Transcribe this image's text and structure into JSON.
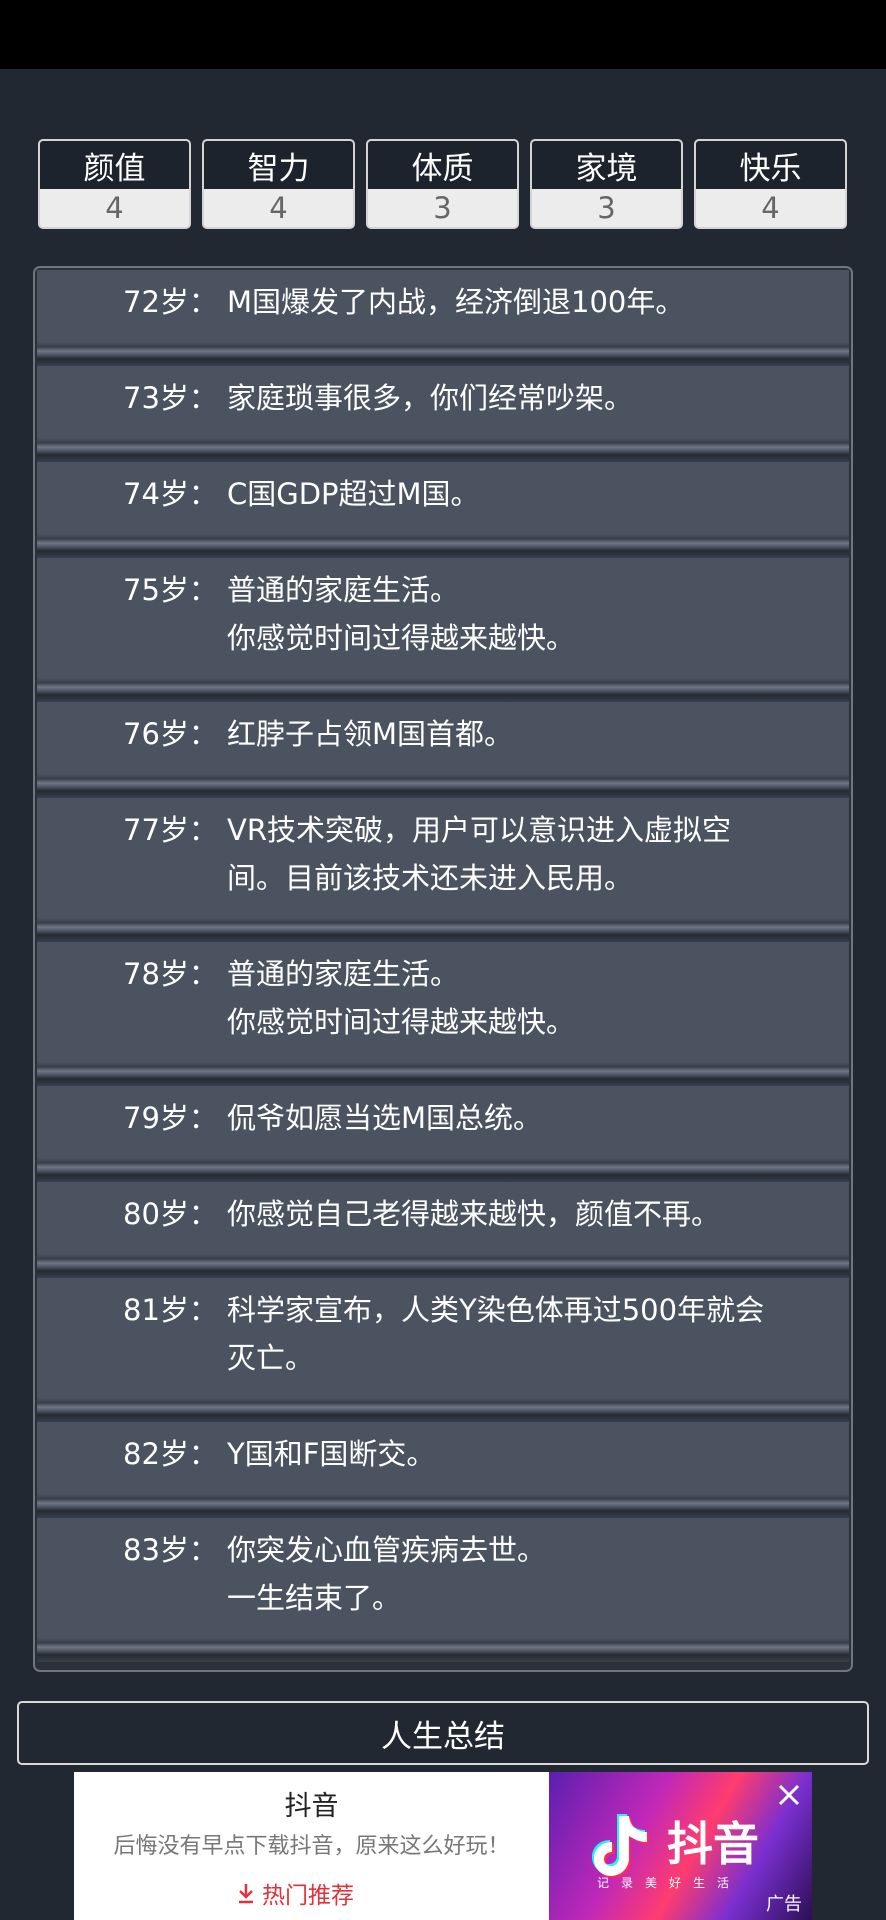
{
  "stats": [
    {
      "label": "颜值",
      "value": "4"
    },
    {
      "label": "智力",
      "value": "4"
    },
    {
      "label": "体质",
      "value": "3"
    },
    {
      "label": "家境",
      "value": "3"
    },
    {
      "label": "快乐",
      "value": "4"
    }
  ],
  "events": [
    {
      "age": "72岁：",
      "lines": [
        "M国爆发了内战，经济倒退100年。"
      ]
    },
    {
      "age": "73岁：",
      "lines": [
        "家庭琐事很多，你们经常吵架。"
      ]
    },
    {
      "age": "74岁：",
      "lines": [
        "C国GDP超过M国。"
      ]
    },
    {
      "age": "75岁：",
      "lines": [
        "普通的家庭生活。",
        "你感觉时间过得越来越快。"
      ]
    },
    {
      "age": "76岁：",
      "lines": [
        "红脖子占领M国首都。"
      ]
    },
    {
      "age": "77岁：",
      "lines": [
        "VR技术突破，用户可以意识进入虚拟空",
        "间。目前该技术还未进入民用。"
      ]
    },
    {
      "age": "78岁：",
      "lines": [
        "普通的家庭生活。",
        "你感觉时间过得越来越快。"
      ]
    },
    {
      "age": "79岁：",
      "lines": [
        "侃爷如愿当选M国总统。"
      ]
    },
    {
      "age": "80岁：",
      "lines": [
        "你感觉自己老得越来越快，颜值不再。"
      ]
    },
    {
      "age": "81岁：",
      "lines": [
        "科学家宣布，人类Y染色体再过500年就会",
        "灭亡。"
      ]
    },
    {
      "age": "82岁：",
      "lines": [
        "Y国和F国断交。"
      ]
    },
    {
      "age": "83岁：",
      "lines": [
        "你突发心血管疾病去世。",
        "一生结束了。"
      ]
    }
  ],
  "summary_button": "人生总结",
  "ad": {
    "title": "抖音",
    "description": "后悔没有早点下载抖音，原来这么好玩！",
    "cta": "热门推荐",
    "brand": "抖音",
    "slogan": "记录美好生活",
    "badge": "广告",
    "close_icon": "close-icon",
    "cta_icon": "download-arrow-icon",
    "logo_icon": "douyin-note-icon"
  },
  "colors": {
    "background": "#222831",
    "event_card": "#4b5361",
    "stat_header": "#1d232c",
    "stat_value_bg": "#ececec",
    "ad_cta": "#e0323a"
  }
}
